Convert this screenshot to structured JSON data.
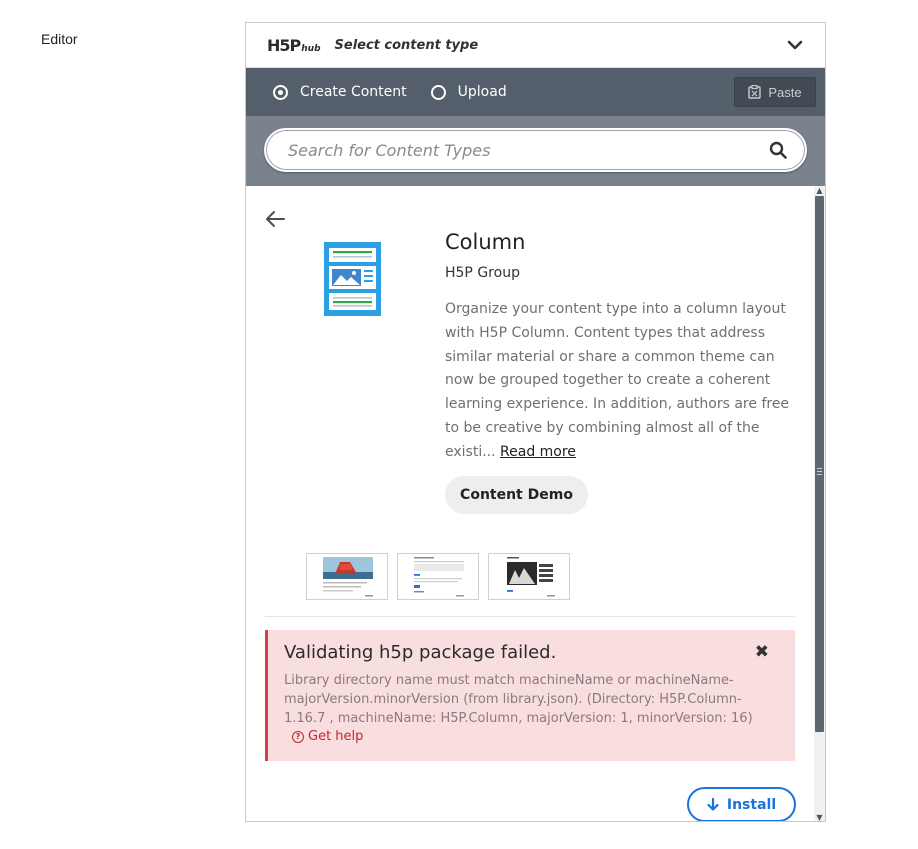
{
  "page": {
    "field_label": "Editor"
  },
  "hub": {
    "logo_main": "H5P",
    "logo_sub": "hub",
    "title": "Select content type"
  },
  "tabs": {
    "create_label": "Create Content",
    "upload_label": "Upload",
    "paste_label": "Paste"
  },
  "search": {
    "placeholder": "Search for Content Types"
  },
  "content_type": {
    "title": "Column",
    "owner": "H5P Group",
    "description": "Organize your content type into a column layout with H5P Column. Content types that address similar material or share a common theme can now be grouped together to create a coherent learning experience. In addition, authors are free to be creative by combining almost all of the existi...",
    "read_more": "Read more",
    "demo_label": "Content Demo"
  },
  "error": {
    "title": "Validating h5p package failed.",
    "message": "Library directory name must match machineName or machineName-majorVersion.minorVersion (from library.json). (Directory: H5P.Column-1.16.7 , machineName: H5P.Column, majorVersion: 1, minorVersion: 16)",
    "help": "Get help"
  },
  "install_label": "Install",
  "colors": {
    "tab_bar": "#555f6b",
    "error_bg": "#f9dedf",
    "error_border": "#d33f49",
    "accent": "#1a73d9",
    "icon_blue": "#2d9fe3",
    "icon_green": "#30a64a"
  }
}
